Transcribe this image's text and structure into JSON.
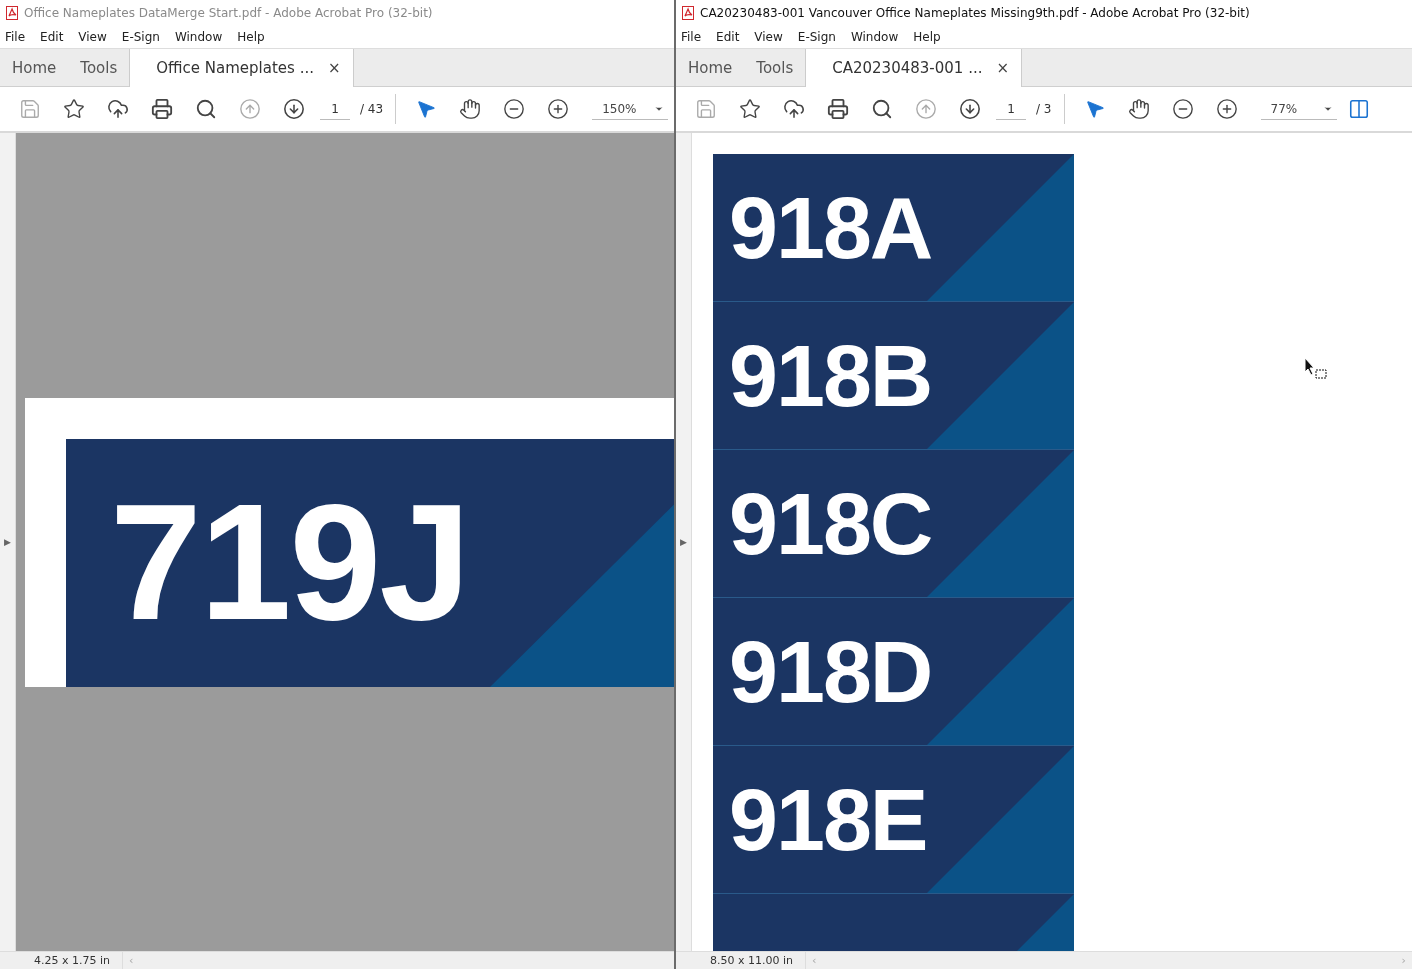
{
  "windows": [
    {
      "title": "Office Nameplates DataMerge Start.pdf - Adobe Acrobat Pro (32-bit)",
      "active": false,
      "kind": "single",
      "menu": [
        "File",
        "Edit",
        "View",
        "E-Sign",
        "Window",
        "Help"
      ],
      "tabs": [
        {
          "label": "Home",
          "selected": false
        },
        {
          "label": "Tools",
          "selected": false
        },
        {
          "label": "Office Nameplates ...",
          "selected": true,
          "close": "×"
        }
      ],
      "page_current": "1",
      "page_total": "/ 43",
      "zoom": "150%",
      "fit_button": false,
      "side_arrow": "▶",
      "plates": [
        {
          "kind": "label",
          "text": "719J"
        }
      ],
      "page_size": "4.25 x 1.75 in",
      "scroll_left": "‹"
    },
    {
      "title": "CA20230483-001 Vancouver Office Nameplates Missing9th.pdf - Adobe Acrobat Pro (32-bit)",
      "active": true,
      "kind": "stack",
      "menu": [
        "File",
        "Edit",
        "View",
        "E-Sign",
        "Window",
        "Help"
      ],
      "tabs": [
        {
          "label": "Home",
          "selected": false
        },
        {
          "label": "Tools",
          "selected": false
        },
        {
          "label": "CA20230483-001 ...",
          "selected": true,
          "close": "×"
        }
      ],
      "page_current": "1",
      "page_total": "/ 3",
      "zoom": "77%",
      "fit_button": true,
      "side_arrow": "▶",
      "plates": [
        {
          "kind": "label",
          "text": "918A"
        },
        {
          "kind": "label",
          "text": "918B"
        },
        {
          "kind": "label",
          "text": "918C"
        },
        {
          "kind": "label",
          "text": "918D"
        },
        {
          "kind": "label",
          "text": "918E"
        },
        {
          "kind": "cut"
        }
      ],
      "page_size": "8.50 x 11.00 in",
      "scroll_left": "‹",
      "scroll_right": "›"
    }
  ]
}
